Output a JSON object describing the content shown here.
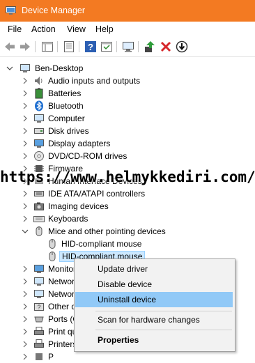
{
  "window": {
    "title": "Device Manager"
  },
  "menu": {
    "items": [
      "File",
      "Action",
      "View",
      "Help"
    ]
  },
  "tree": {
    "root": "Ben-Desktop",
    "items": [
      "Audio inputs and outputs",
      "Batteries",
      "Bluetooth",
      "Computer",
      "Disk drives",
      "Display adapters",
      "DVD/CD-ROM drives",
      "Firmware",
      "Human Interface Devices",
      "IDE ATA/ATAPI controllers",
      "Imaging devices",
      "Keyboards",
      "Mice and other pointing devices",
      "HID-compliant mouse",
      "HID-compliant mouse",
      "Monitors",
      "Network adapters",
      "Network",
      "Other devices",
      "Ports (COM & LPT)",
      "Print queues",
      "Printers",
      "P"
    ]
  },
  "watermark": "https://www.helmykkediri.com/",
  "context_menu": {
    "items": [
      "Update driver",
      "Disable device",
      "Uninstall device",
      "Scan for hardware changes",
      "Properties"
    ]
  },
  "colors": {
    "titlebar": "#f37a22",
    "selection": "#cce8ff",
    "menu_hover": "#91c9f7"
  }
}
